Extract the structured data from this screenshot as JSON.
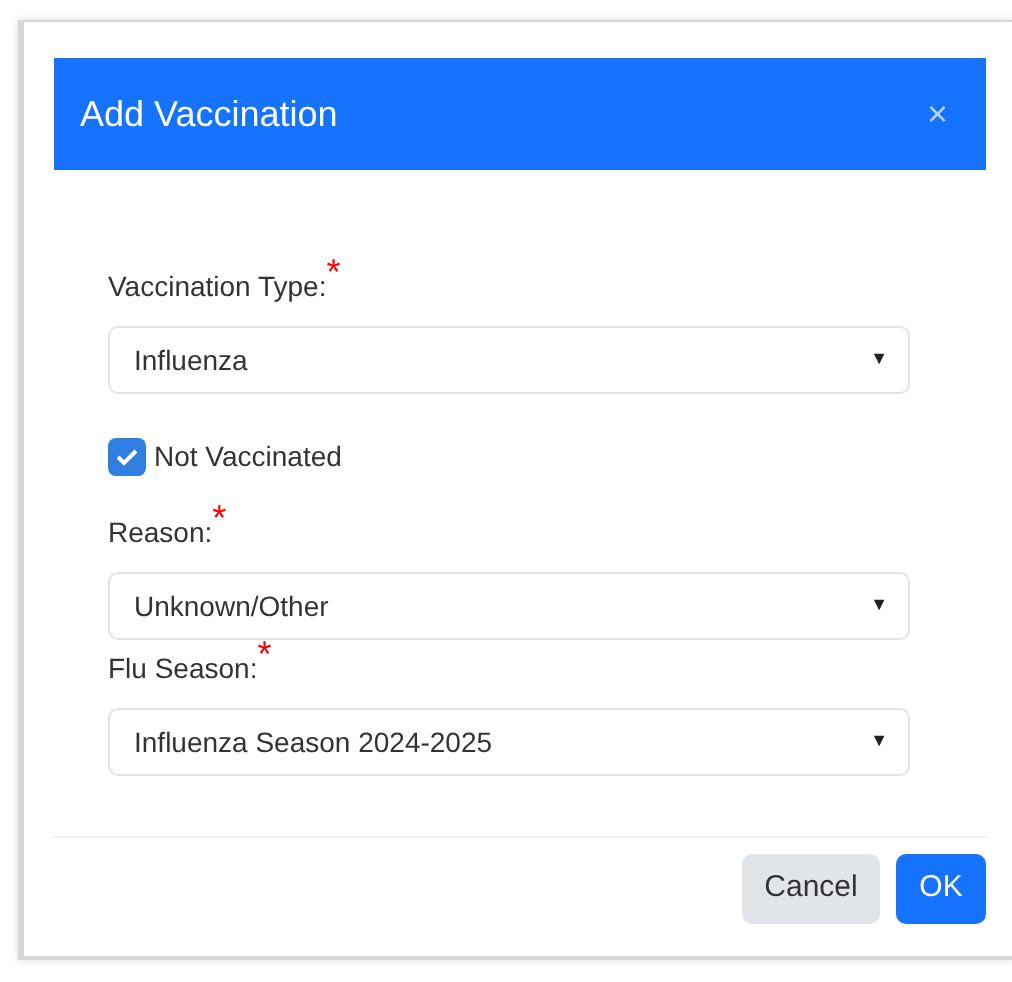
{
  "dialog": {
    "title": "Add Vaccination",
    "close": "×"
  },
  "fields": [
    {
      "kind": "select",
      "label": "Vaccination Type:",
      "required": true,
      "value": "Influenza",
      "caret": "▼"
    },
    {
      "kind": "checkbox",
      "label": "Not Vaccinated",
      "checked": true
    },
    {
      "kind": "select",
      "label": "Reason:",
      "required": true,
      "value": "Unknown/Other",
      "caret": "▼"
    },
    {
      "kind": "select",
      "label": "Flu Season:",
      "required": true,
      "value": "Influenza Season 2024-2025",
      "caret": "▼"
    }
  ],
  "required_mark": "*",
  "buttons": [
    {
      "label": "Cancel",
      "kind": "secondary"
    },
    {
      "label": "OK",
      "kind": "primary"
    }
  ]
}
